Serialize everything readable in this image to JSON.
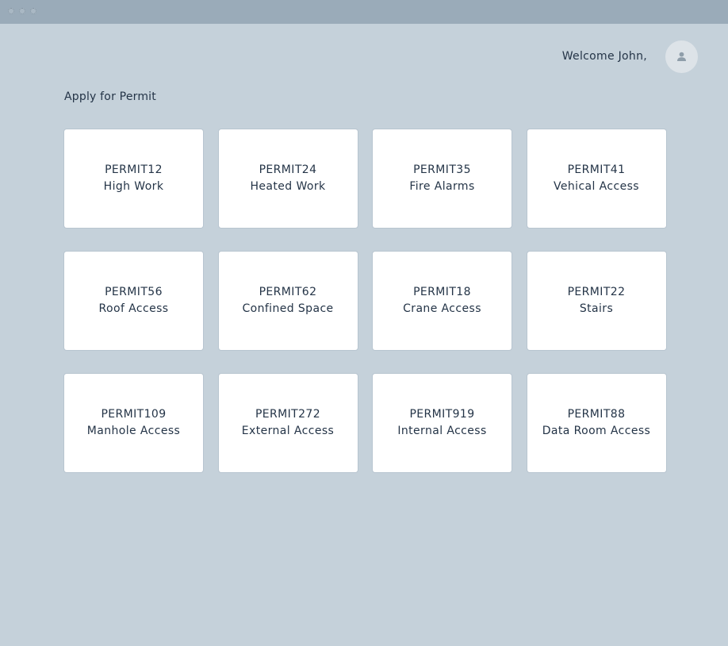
{
  "window": {
    "controls": [
      "close",
      "minimize",
      "maximize"
    ]
  },
  "header": {
    "welcome_text": "Welcome John,",
    "avatar_icon": "user-icon"
  },
  "main": {
    "section_title": "Apply for Permit",
    "permits": [
      {
        "code": "PERMIT12",
        "name": "High Work"
      },
      {
        "code": "PERMIT24",
        "name": "Heated Work"
      },
      {
        "code": "PERMIT35",
        "name": "Fire Alarms"
      },
      {
        "code": "PERMIT41",
        "name": "Vehical Access"
      },
      {
        "code": "PERMIT56",
        "name": "Roof Access"
      },
      {
        "code": "PERMIT62",
        "name": "Confined Space"
      },
      {
        "code": "PERMIT18",
        "name": "Crane Access"
      },
      {
        "code": "PERMIT22",
        "name": "Stairs"
      },
      {
        "code": "PERMIT109",
        "name": "Manhole Access"
      },
      {
        "code": "PERMIT272",
        "name": "External Access"
      },
      {
        "code": "PERMIT919",
        "name": "Internal Access"
      },
      {
        "code": "PERMIT88",
        "name": "Data Room Access"
      }
    ]
  },
  "colors": {
    "background": "#c5d1da",
    "titlebar": "#9aabb9",
    "card": "#ffffff",
    "text": "#243447"
  }
}
